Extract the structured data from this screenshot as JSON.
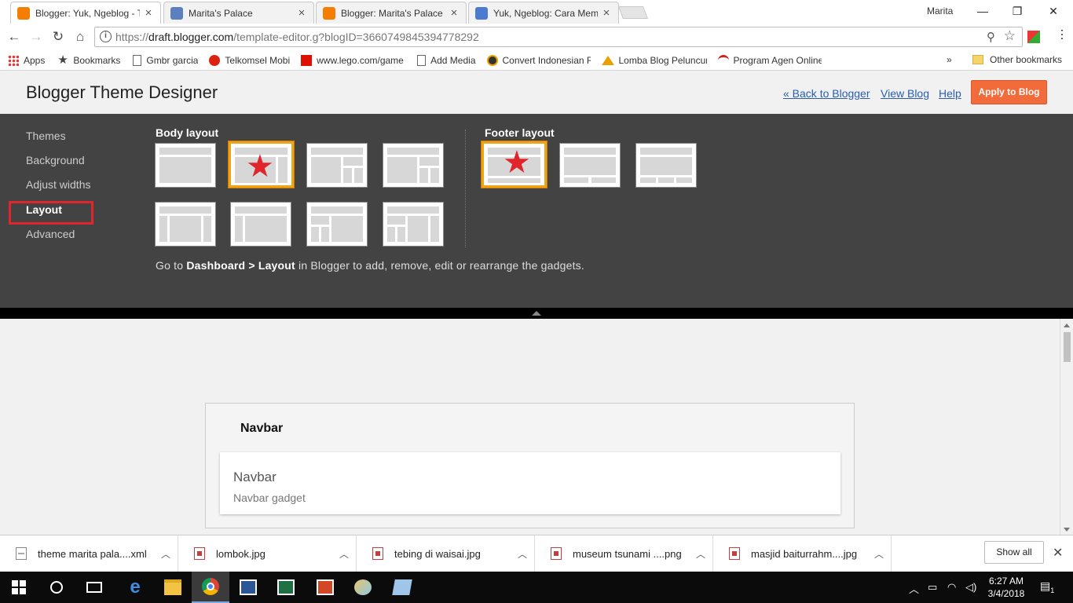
{
  "tabs": [
    {
      "title": "Blogger: Yuk, Ngeblog - T",
      "favicon_color": "#f57d00",
      "active": true
    },
    {
      "title": "Marita's Palace",
      "favicon_color": "#5b7fbf",
      "active": false
    },
    {
      "title": "Blogger: Marita's Palace",
      "favicon_color": "#f57d00",
      "active": false
    },
    {
      "title": "Yuk, Ngeblog: Cara Mem",
      "favicon_color": "#4a7bd0",
      "active": false
    }
  ],
  "window": {
    "user": "Marita"
  },
  "address": {
    "url_prefix": "https://",
    "url_host": "draft.blogger.com",
    "url_path": "/template-editor.g?blogID=3660749845394778292"
  },
  "bookmarks": [
    {
      "label": "Apps",
      "icon": "apps-grid-icon"
    },
    {
      "label": "Bookmarks",
      "icon": "star-icon"
    },
    {
      "label": "Gmbr garcia",
      "icon": "page-icon"
    },
    {
      "label": "Telkomsel Mobi",
      "icon": "telkomsel-icon"
    },
    {
      "label": "www.lego.com/game",
      "icon": "lego-icon"
    },
    {
      "label": "Add Media",
      "icon": "page-icon"
    },
    {
      "label": "Convert Indonesian R",
      "icon": "convert-icon"
    },
    {
      "label": "Lomba Blog Peluncur",
      "icon": "lomba-icon"
    },
    {
      "label": "Program Agen Online",
      "icon": "agen-icon"
    }
  ],
  "bookmarks_more": "»",
  "other_bookmarks": "Other bookmarks",
  "designer": {
    "title": "Blogger Theme Designer",
    "links": {
      "back": "« Back to Blogger",
      "view": "View Blog",
      "help": "Help"
    },
    "apply": "Apply to Blog",
    "sidebar": [
      "Themes",
      "Background",
      "Adjust widths",
      "Layout",
      "Advanced"
    ],
    "body_layout_title": "Body layout",
    "footer_layout_title": "Footer layout",
    "hint_pre": "Go to ",
    "hint_bold": "Dashboard > Layout",
    "hint_post": " in Blogger to add, remove, edit or rearrange the gadgets."
  },
  "preview": {
    "section_title": "Navbar",
    "gadget_title": "Navbar",
    "gadget_subtitle": "Navbar gadget"
  },
  "downloads": [
    {
      "name": "theme marita pala....xml",
      "type": "doc"
    },
    {
      "name": "lombok.jpg",
      "type": "img"
    },
    {
      "name": "tebing di waisai.jpg",
      "type": "img"
    },
    {
      "name": "museum tsunami ....png",
      "type": "img"
    },
    {
      "name": "masjid baiturrahm....jpg",
      "type": "img"
    }
  ],
  "downloads_show_all": "Show all",
  "clock": {
    "time": "6:27 AM",
    "date": "3/4/2018"
  },
  "notification_count": "1",
  "colors": {
    "accent_orange": "#f26b3a",
    "selected_border": "#f2a11a",
    "highlight_red": "#e0262c",
    "link_blue": "#2a5db0"
  }
}
